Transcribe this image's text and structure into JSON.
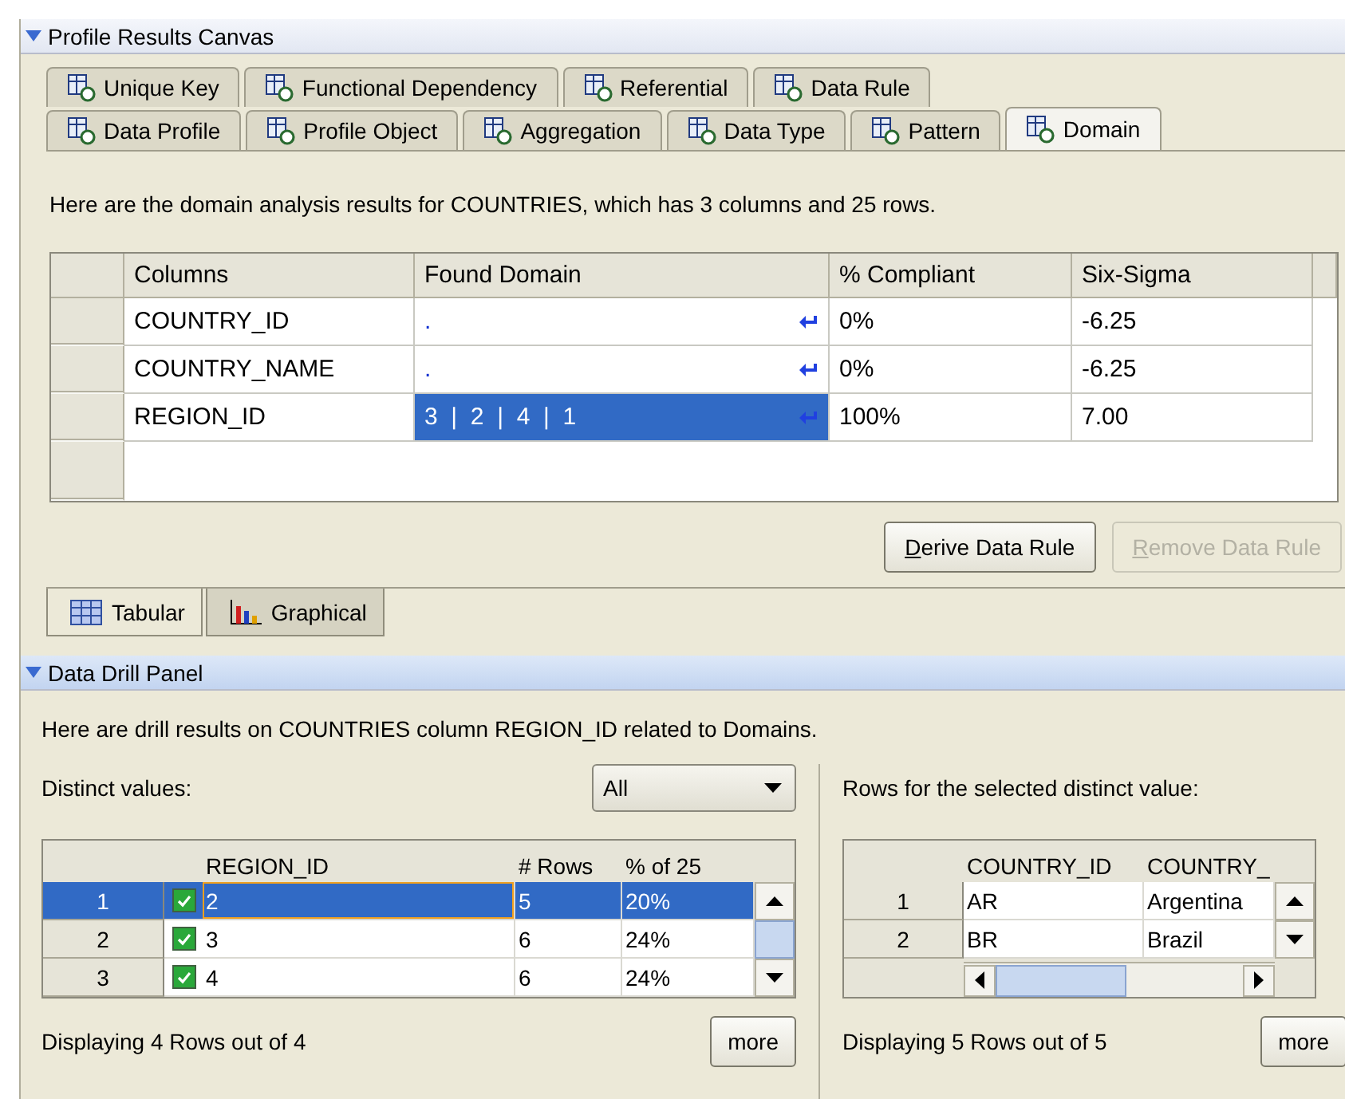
{
  "canvas": {
    "title": "Profile Results Canvas"
  },
  "tab_rows": [
    [
      {
        "label": "Unique Key",
        "selected": false
      },
      {
        "label": "Functional Dependency",
        "selected": false
      },
      {
        "label": "Referential",
        "selected": false
      },
      {
        "label": "Data Rule",
        "selected": false
      }
    ],
    [
      {
        "label": "Data Profile",
        "selected": false
      },
      {
        "label": "Profile Object",
        "selected": false
      },
      {
        "label": "Aggregation",
        "selected": false
      },
      {
        "label": "Data Type",
        "selected": false
      },
      {
        "label": "Pattern",
        "selected": false
      },
      {
        "label": "Domain",
        "selected": true
      }
    ]
  ],
  "description": "Here are the domain analysis results for COUNTRIES, which has 3 columns and 25 rows.",
  "results_table": {
    "columns": [
      "Columns",
      "Found Domain",
      "% Compliant",
      "Six-Sigma"
    ],
    "rows": [
      {
        "cells": [
          "COUNTRY_ID",
          ".",
          "0%",
          "-6.25"
        ],
        "selected": false
      },
      {
        "cells": [
          "COUNTRY_NAME",
          ".",
          "0%",
          "-6.25"
        ],
        "selected": false
      },
      {
        "cells": [
          "REGION_ID",
          "3  |  2  |  4  |  1",
          "100%",
          "7.00"
        ],
        "selected": true
      }
    ]
  },
  "actions": [
    {
      "label": "Derive Data Rule",
      "disabled": false
    },
    {
      "label": "Remove Data Rule",
      "disabled": true
    }
  ],
  "view_tabs": [
    {
      "label": "Tabular",
      "selected": true
    },
    {
      "label": "Graphical",
      "selected": false
    }
  ],
  "drill_panel": {
    "title": "Data Drill Panel",
    "description": "Here are drill results on COUNTRIES column REGION_ID related to Domains.",
    "distinct_label": "Distinct values:",
    "distinct_filter": "All",
    "distinct_table": {
      "columns": [
        "REGION_ID",
        "# Rows",
        "% of 25"
      ],
      "rows": [
        {
          "index": "1",
          "checked": true,
          "selected": true,
          "cells": [
            "2",
            "5",
            "20%"
          ]
        },
        {
          "index": "2",
          "checked": true,
          "selected": false,
          "cells": [
            "3",
            "6",
            "24%"
          ]
        },
        {
          "index": "3",
          "checked": true,
          "selected": false,
          "cells": [
            "4",
            "6",
            "24%"
          ]
        }
      ]
    },
    "distinct_status": "Displaying 4 Rows out of 4",
    "distinct_more": "more",
    "rows_label": "Rows for the selected distinct value:",
    "rows_table": {
      "columns": [
        "COUNTRY_ID",
        "COUNTRY_"
      ],
      "rows": [
        {
          "index": "1",
          "cells": [
            "AR",
            "Argentina"
          ]
        },
        {
          "index": "2",
          "cells": [
            "BR",
            "Brazil"
          ]
        }
      ]
    },
    "rows_status": "Displaying 5 Rows out of 5",
    "rows_more": "more"
  }
}
